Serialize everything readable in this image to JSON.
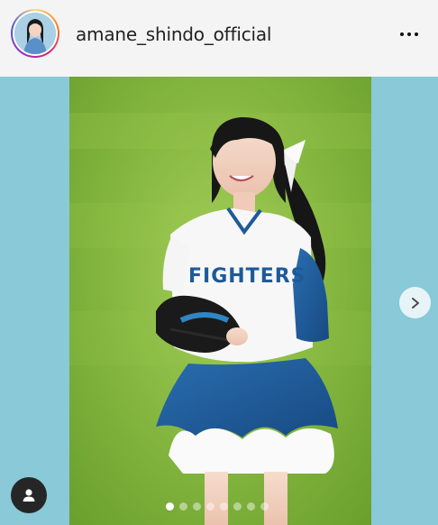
{
  "header": {
    "username": "amane_shindo_official",
    "more_icon": "more-horizontal-icon"
  },
  "post": {
    "jersey_text": "FIGHTERS",
    "carousel_count": 8,
    "carousel_active_index": 0,
    "next_icon": "chevron-right-icon",
    "profile_icon": "user-icon"
  },
  "colors": {
    "background_left_right": "#89c9d8",
    "grass": "#8cbf42",
    "jersey_blue": "#1e5a9a"
  }
}
